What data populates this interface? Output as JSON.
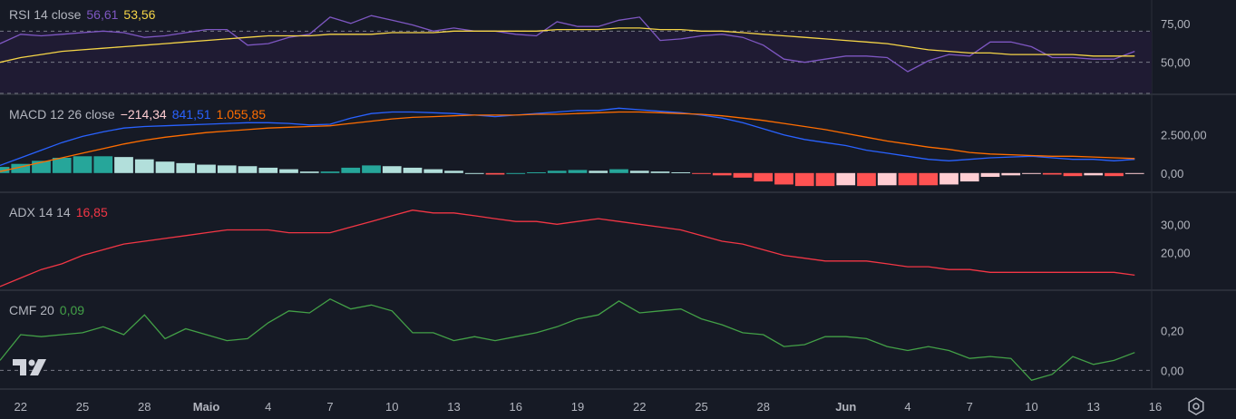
{
  "colors": {
    "background": "#161a25",
    "separator": "#2a2e39",
    "text": "#b2b5be",
    "rsi": "#7e57c2",
    "rsi_ma": "#f5d547",
    "rsi_band_fill": "#1f1b33",
    "macd": "#2962ff",
    "signal": "#ff6d00",
    "hist_up_strong": "#26a69a",
    "hist_up_weak": "#b2dfdb",
    "hist_down_strong": "#ff5252",
    "hist_down_weak": "#ffcdd2",
    "adx": "#f23645",
    "cmf": "#43a047",
    "dashed": "#787b86"
  },
  "panes": {
    "rsi": {
      "label": "RSI 14 close",
      "value1": "56,61",
      "value2": "53,56",
      "ticks": [
        {
          "v": 75,
          "t": "75,00"
        },
        {
          "v": 50,
          "t": "50,00"
        }
      ],
      "range": [
        30,
        90
      ],
      "band": [
        30,
        70
      ]
    },
    "macd": {
      "label": "MACD 12 26 close",
      "value1": "−214,34",
      "value2": "841,51",
      "value3": "1.055,85",
      "ticks": [
        {
          "v": 2500,
          "t": "2.500,00"
        },
        {
          "v": 0,
          "t": "0,00"
        }
      ],
      "range": [
        -1200,
        5100
      ]
    },
    "adx": {
      "label": "ADX 14 14",
      "value1": "16,85",
      "ticks": [
        {
          "v": 30,
          "t": "30,00"
        },
        {
          "v": 20,
          "t": "20,00"
        }
      ],
      "range": [
        7,
        41
      ]
    },
    "cmf": {
      "label": "CMF 20",
      "value1": "0,09",
      "ticks": [
        {
          "v": 0.2,
          "t": "0,20"
        },
        {
          "v": 0,
          "t": "0,00"
        }
      ],
      "range": [
        -0.09,
        0.4
      ]
    }
  },
  "x_axis": {
    "labels": [
      {
        "i": 1,
        "t": "22"
      },
      {
        "i": 4,
        "t": "25"
      },
      {
        "i": 7,
        "t": "28"
      },
      {
        "i": 10,
        "t": "Maio"
      },
      {
        "i": 13,
        "t": "4"
      },
      {
        "i": 16,
        "t": "7"
      },
      {
        "i": 19,
        "t": "10"
      },
      {
        "i": 22,
        "t": "13"
      },
      {
        "i": 25,
        "t": "16"
      },
      {
        "i": 28,
        "t": "19"
      },
      {
        "i": 31,
        "t": "22"
      },
      {
        "i": 34,
        "t": "25"
      },
      {
        "i": 37,
        "t": "28"
      },
      {
        "i": 41,
        "t": "Jun"
      },
      {
        "i": 44,
        "t": "4"
      },
      {
        "i": 47,
        "t": "7"
      },
      {
        "i": 50,
        "t": "10"
      },
      {
        "i": 53,
        "t": "13"
      },
      {
        "i": 56,
        "t": "16"
      }
    ]
  },
  "chart_data": [
    {
      "type": "line",
      "title": "RSI 14 close",
      "series": [
        {
          "name": "RSI",
          "values": [
            62,
            68,
            67,
            68,
            69,
            70,
            69,
            66,
            67,
            69,
            71,
            71,
            61,
            62,
            66,
            68,
            79,
            75,
            80,
            77,
            74,
            70,
            72,
            70,
            70,
            68,
            67,
            76,
            73,
            73,
            77,
            79,
            64,
            65,
            67,
            68,
            66,
            61,
            52,
            50,
            52,
            54,
            54,
            53,
            44,
            51,
            55,
            54,
            63,
            63,
            60,
            53,
            53,
            52,
            52,
            57
          ]
        },
        {
          "name": "RSI MA",
          "values": [
            50,
            53,
            55,
            57,
            58,
            59,
            60,
            61,
            62,
            63,
            64,
            65,
            66,
            67,
            67,
            67,
            68,
            68,
            68,
            69,
            69,
            69,
            70,
            70,
            70,
            70,
            70,
            71,
            71,
            71,
            72,
            72,
            71,
            71,
            70,
            70,
            69,
            68,
            67,
            66,
            65,
            64,
            63,
            62,
            60,
            58,
            57,
            56,
            56,
            55,
            55,
            55,
            55,
            54,
            54,
            54
          ]
        }
      ]
    },
    {
      "type": "line",
      "title": "MACD 12 26 close",
      "series": [
        {
          "name": "MACD",
          "values": [
            500,
            1000,
            1500,
            2000,
            2400,
            2700,
            2950,
            3050,
            3100,
            3150,
            3200,
            3250,
            3300,
            3300,
            3250,
            3150,
            3200,
            3600,
            3900,
            4000,
            4000,
            3950,
            3900,
            3800,
            3700,
            3800,
            3900,
            4000,
            4100,
            4100,
            4250,
            4150,
            4050,
            3950,
            3800,
            3600,
            3300,
            2900,
            2500,
            2200,
            2000,
            1800,
            1500,
            1300,
            1100,
            900,
            800,
            900,
            1000,
            1050,
            1100,
            1000,
            900,
            900,
            800,
            900
          ]
        },
        {
          "name": "Signal",
          "values": [
            100,
            400,
            700,
            1000,
            1300,
            1600,
            1900,
            2150,
            2350,
            2500,
            2650,
            2750,
            2850,
            2950,
            3000,
            3050,
            3100,
            3250,
            3400,
            3550,
            3650,
            3700,
            3750,
            3800,
            3800,
            3800,
            3850,
            3850,
            3900,
            3950,
            4000,
            4000,
            3950,
            3900,
            3850,
            3750,
            3600,
            3450,
            3250,
            3050,
            2850,
            2600,
            2350,
            2100,
            1900,
            1700,
            1550,
            1350,
            1250,
            1200,
            1150,
            1100,
            1100,
            1050,
            1000,
            950
          ]
        },
        {
          "name": "Histogram",
          "values": [
            400,
            600,
            800,
            1000,
            1100,
            1100,
            1050,
            900,
            750,
            650,
            550,
            500,
            450,
            350,
            250,
            100,
            100,
            350,
            500,
            450,
            350,
            250,
            150,
            0,
            -100,
            0,
            50,
            150,
            200,
            150,
            250,
            150,
            100,
            50,
            -50,
            -150,
            -300,
            -550,
            -750,
            -850,
            -850,
            -800,
            -850,
            -800,
            -800,
            -800,
            -750,
            -550,
            -250,
            -150,
            -50,
            -100,
            -200,
            -150,
            -200,
            -50
          ]
        }
      ]
    },
    {
      "type": "line",
      "title": "ADX 14 14",
      "series": [
        {
          "name": "ADX",
          "values": [
            8,
            11,
            14,
            16,
            19,
            21,
            23,
            24,
            25,
            26,
            27,
            28,
            28,
            28,
            27,
            27,
            27,
            29,
            31,
            33,
            35,
            34,
            34,
            33,
            32,
            31,
            31,
            30,
            31,
            32,
            31,
            30,
            29,
            28,
            26,
            24,
            23,
            21,
            19,
            18,
            17,
            17,
            17,
            16,
            15,
            15,
            14,
            14,
            13,
            13,
            13,
            13,
            13,
            13,
            13,
            12
          ]
        }
      ]
    },
    {
      "type": "line",
      "title": "CMF 20",
      "series": [
        {
          "name": "CMF",
          "values": [
            0.05,
            0.18,
            0.17,
            0.18,
            0.19,
            0.22,
            0.18,
            0.28,
            0.16,
            0.21,
            0.18,
            0.15,
            0.16,
            0.24,
            0.3,
            0.29,
            0.36,
            0.31,
            0.33,
            0.3,
            0.19,
            0.19,
            0.15,
            0.17,
            0.15,
            0.17,
            0.19,
            0.22,
            0.26,
            0.28,
            0.35,
            0.29,
            0.3,
            0.31,
            0.26,
            0.23,
            0.19,
            0.18,
            0.12,
            0.13,
            0.17,
            0.17,
            0.16,
            0.12,
            0.1,
            0.12,
            0.1,
            0.06,
            0.07,
            0.06,
            -0.05,
            -0.02,
            0.07,
            0.03,
            0.05,
            0.09
          ]
        }
      ]
    }
  ]
}
